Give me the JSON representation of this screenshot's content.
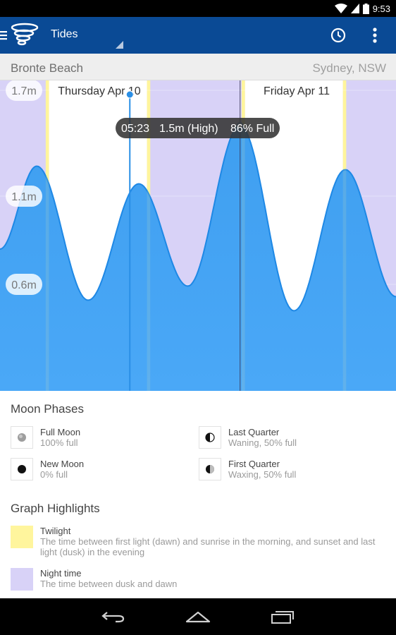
{
  "status_bar": {
    "time": "9:53",
    "icons": [
      "wifi-icon",
      "signal-icon",
      "battery-icon"
    ]
  },
  "app_bar": {
    "title": "Tides",
    "icons": [
      "menu-icon",
      "app-logo-icon",
      "clock-icon",
      "overflow-menu-icon"
    ],
    "color": "#0a4a95"
  },
  "location": {
    "name": "Bronte Beach",
    "region": "Sydney, NSW"
  },
  "chart_data": {
    "type": "area",
    "x_unit": "hours from midnight Thursday Apr 10",
    "x_range": [
      -6,
      42.5
    ],
    "ylim": [
      0,
      2.0
    ],
    "y_ticks": [
      "0.6m",
      "1.1m",
      "1.7m"
    ],
    "y_tick_values": [
      0.6,
      1.1,
      1.7
    ],
    "day_labels": [
      {
        "label": "Thursday Apr 10",
        "day_start": 0
      },
      {
        "label": "Friday Apr 11",
        "day_start": 24
      }
    ],
    "tide_points": [
      {
        "x": -6.0,
        "y": 0.8
      },
      {
        "x": -1.5,
        "y": 1.27
      },
      {
        "x": 4.8,
        "y": 0.51
      },
      {
        "x": 11.0,
        "y": 1.17
      },
      {
        "x": 17.0,
        "y": 0.59
      },
      {
        "x": 23.4,
        "y": 1.5
      },
      {
        "x": 30.0,
        "y": 0.45
      },
      {
        "x": 36.3,
        "y": 1.25
      },
      {
        "x": 42.5,
        "y": 0.53
      }
    ],
    "night_periods": [
      [
        -6,
        0
      ],
      [
        12,
        24
      ],
      [
        36,
        42.5
      ]
    ],
    "twilight_periods": [
      [
        -0.4,
        0
      ],
      [
        12,
        12.4
      ],
      [
        23.6,
        24
      ],
      [
        36,
        36.4
      ]
    ],
    "now_marker_x": 9.9,
    "selected": {
      "x": 29.383,
      "x_display": 23.4,
      "y": 1.5,
      "time": "05:23",
      "height": "1.5m (High)",
      "moon": "86% Full"
    },
    "colors": {
      "tide_fill": "#42a5f5",
      "tide_line": "#1e88e5",
      "night": "#d8d2f7",
      "twilight": "#fff59d",
      "day": "#ffffff"
    }
  },
  "moon_phases": {
    "title": "Moon Phases",
    "items": [
      {
        "name": "Full Moon",
        "detail": "100% full",
        "icon": "full-moon-icon"
      },
      {
        "name": "Last Quarter",
        "detail": "Waning, 50% full",
        "icon": "last-quarter-moon-icon"
      },
      {
        "name": "New Moon",
        "detail": "0% full",
        "icon": "new-moon-icon"
      },
      {
        "name": "First Quarter",
        "detail": "Waxing, 50% full",
        "icon": "first-quarter-moon-icon"
      }
    ]
  },
  "graph_highlights": {
    "title": "Graph Highlights",
    "items": [
      {
        "name": "Twilight",
        "detail": "The time between first light (dawn) and sunrise in the morning, and sunset and last light (dusk) in the evening",
        "color": "#fff59d"
      },
      {
        "name": "Night time",
        "detail": "The time between dusk and dawn",
        "color": "#d8d2f7"
      }
    ]
  },
  "nav_bar": {
    "icons": [
      "back-icon",
      "home-icon",
      "recent-apps-icon"
    ]
  }
}
